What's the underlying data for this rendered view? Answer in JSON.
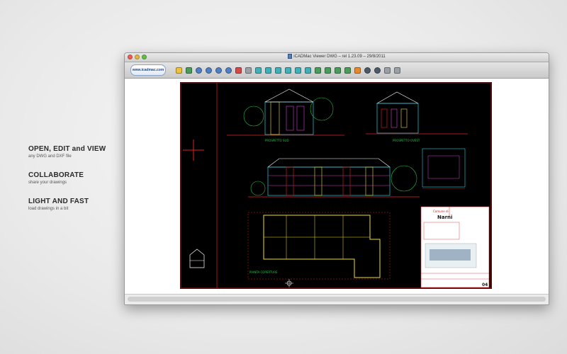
{
  "features": [
    {
      "title": "OPEN, EDIT and VIEW",
      "subtitle": "any DWG and DXF file"
    },
    {
      "title": "COLLABORATE",
      "subtitle": "share your drawings"
    },
    {
      "title": "LIGHT AND FAST",
      "subtitle": "load drawings in a bit"
    }
  ],
  "window": {
    "title": "iCADMac Viewer DWG – rel 1.23.09 – 29/8/2011",
    "logo": "www.icadmac.com"
  },
  "toolbar": {
    "tools": [
      {
        "icon": "open-folder-icon",
        "cls": "t-yel"
      },
      {
        "icon": "edit-icon",
        "cls": "t-grn"
      },
      {
        "icon": "zoom-in-icon",
        "cls": "t-blu t-round"
      },
      {
        "icon": "zoom-out-icon",
        "cls": "t-blu t-round"
      },
      {
        "icon": "zoom-window-icon",
        "cls": "t-blu t-round"
      },
      {
        "icon": "zoom-extents-icon",
        "cls": "t-blu t-round"
      },
      {
        "icon": "pan-icon",
        "cls": "t-red"
      },
      {
        "icon": "regen-icon",
        "cls": "t-gry"
      },
      {
        "icon": "view-top-icon",
        "cls": "t-cyn"
      },
      {
        "icon": "view-bottom-icon",
        "cls": "t-cyn"
      },
      {
        "icon": "view-left-icon",
        "cls": "t-cyn"
      },
      {
        "icon": "view-right-icon",
        "cls": "t-cyn"
      },
      {
        "icon": "view-front-icon",
        "cls": "t-cyn"
      },
      {
        "icon": "view-back-icon",
        "cls": "t-cyn"
      },
      {
        "icon": "iso-sw-icon",
        "cls": "t-grn"
      },
      {
        "icon": "iso-se-icon",
        "cls": "t-grn"
      },
      {
        "icon": "iso-ne-icon",
        "cls": "t-grn"
      },
      {
        "icon": "iso-nw-icon",
        "cls": "t-grn"
      },
      {
        "icon": "layers-icon",
        "cls": "t-org"
      },
      {
        "icon": "shade-flat-icon",
        "cls": "t-dk t-round"
      },
      {
        "icon": "shade-gouraud-icon",
        "cls": "t-dk t-round"
      },
      {
        "icon": "print-icon",
        "cls": "t-gry"
      },
      {
        "icon": "cube-icon",
        "cls": "t-gry"
      }
    ]
  },
  "drawing": {
    "titleblock": {
      "heading": "Comune di",
      "name": "Narni",
      "sheet": "04"
    }
  },
  "colors": {
    "cad_background": "#000000",
    "cad_red": "#e02020",
    "cad_yellow": "#f0e020",
    "cad_cyan": "#20d0e0",
    "cad_green": "#20c040",
    "cad_magenta": "#d040d0"
  }
}
